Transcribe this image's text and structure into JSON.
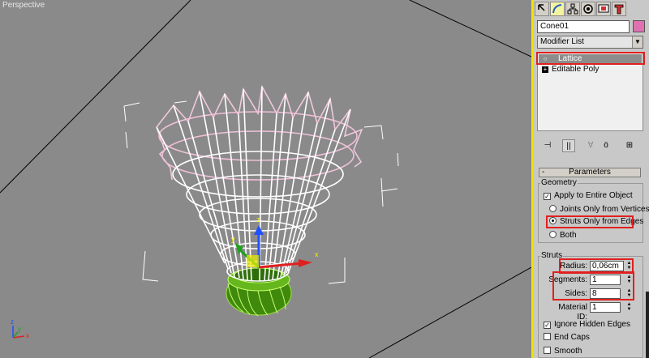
{
  "viewport": {
    "label": "Perspective",
    "axis": {
      "x": "x",
      "y": "y",
      "z": "z"
    }
  },
  "panel": {
    "toolbar": {
      "icons": [
        "create-icon",
        "modify-icon",
        "hierarchy-icon",
        "motion-icon",
        "display-icon",
        "utilities-icon"
      ],
      "active": "modify-icon"
    },
    "object_name": "Cone01",
    "object_color": "#e070b0",
    "modifier_list": "Modifier List",
    "stack": [
      {
        "label": "Lattice",
        "selected": true
      },
      {
        "label": "Editable Poly",
        "selected": false
      }
    ],
    "stack_buttons": [
      "pin-stack-icon",
      "show-end-result-icon",
      "make-unique-icon",
      "remove-modifier-icon",
      "configure-modifier-sets-icon"
    ],
    "rollout": {
      "title": "Parameters",
      "collapse": "-",
      "geometry": {
        "label": "Geometry",
        "apply_entire": "Apply to Entire Object",
        "joints_only": "Joints Only from Vertices",
        "struts_only": "Struts Only from Edges",
        "both": "Both"
      },
      "struts": {
        "label": "Struts",
        "radius_label": "Radius:",
        "radius_value": "0,06cm",
        "segments_label": "Segments:",
        "segments_value": "1",
        "sides_label": "Sides:",
        "sides_value": "8",
        "material_label": "Material ID:",
        "material_value": "1",
        "ignore_hidden": "Ignore Hidden Edges",
        "end_caps": "End Caps",
        "smooth": "Smooth"
      }
    },
    "highlight_color": "#e02020"
  }
}
